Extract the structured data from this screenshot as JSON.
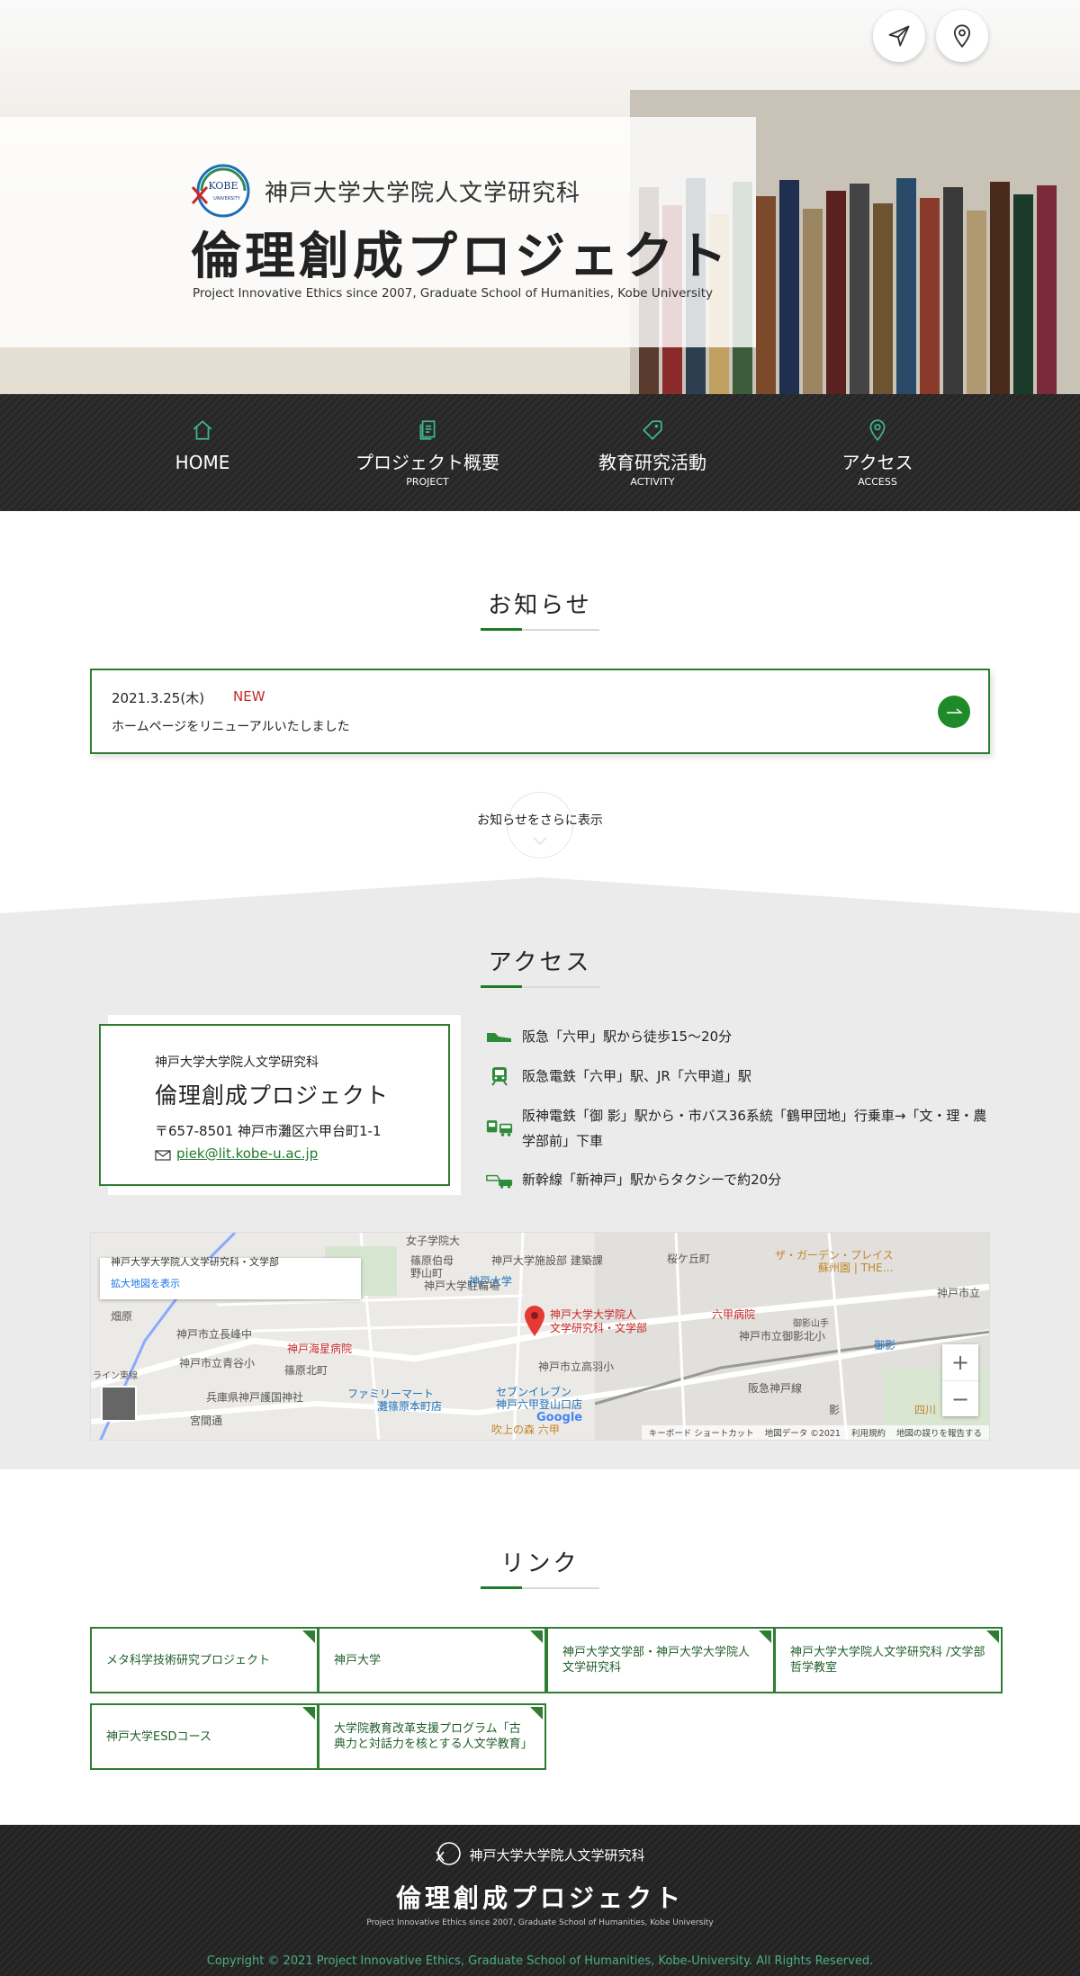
{
  "header": {
    "org_name": "神戸大学大学院人文学研究科",
    "project_title": "倫理創成プロジェクト",
    "subtitle": "Project Innovative Ethics since 2007, Graduate School of Humanities, Kobe University",
    "logo_text_top": "KOBE",
    "logo_text_bottom": "UNIVERSITY",
    "contact_icon": "send-icon",
    "access_icon": "map-pin-icon"
  },
  "nav": {
    "items": [
      {
        "label": "HOME",
        "sub": "",
        "icon": "home-icon"
      },
      {
        "label": "プロジェクト概要",
        "sub": "PROJECT",
        "icon": "document-icon"
      },
      {
        "label": "教育研究活動",
        "sub": "ACTIVITY",
        "icon": "tag-icon"
      },
      {
        "label": "アクセス",
        "sub": "ACCESS",
        "icon": "map-pin-icon"
      }
    ]
  },
  "news": {
    "title": "お知らせ",
    "items": [
      {
        "date": "2021.3.25(木)",
        "badge": "NEW",
        "text": "ホームページをリニューアルいたしました"
      }
    ],
    "more_label": "お知らせをさらに表示"
  },
  "access": {
    "title": "アクセス",
    "card": {
      "org": "神戸大学大学院人文学研究科",
      "project": "倫理創成プロジェクト",
      "address": "〒657-8501 神戸市灘区六甲台町1-1",
      "email": "piek@lit.kobe-u.ac.jp"
    },
    "routes": [
      {
        "icon": "shoe-icon",
        "text": "阪急「六甲」駅から徒歩15〜20分"
      },
      {
        "icon": "train-icon",
        "text": "阪急電鉄「六甲」駅、JR「六甲道」駅"
      },
      {
        "icon": "train-bus-icon",
        "text": "阪神電鉄「御 影」駅から・市バス36系統「鶴甲団地」行乗車→「文・理・農学部前」下車"
      },
      {
        "icon": "shinkansen-taxi-icon",
        "text": "新幹線「新神戸」駅からタクシーで約20分"
      }
    ],
    "map": {
      "place_title": "神戸大学大学院人文学研究科・文学部",
      "enlarge_label": "拡大地図を表示",
      "marker_label_1": "神戸大学大学院人",
      "marker_label_2": "文学研究科・文学部",
      "labels": [
        "女子学院大",
        "篠原伯母",
        "野山町",
        "神戸大学施設部 建築課",
        "桜ケ丘町",
        "ザ・ガーデン・プレイス",
        "蘇州園 | THE…",
        "神戸市立",
        "神戸大学駐輪場",
        "六甲病院",
        "御影山手",
        "神戸市立御影北小",
        "神戸市立長峰中",
        "神戸海星病院",
        "篠原北町",
        "神戸市立高羽小",
        "御影",
        "神戸市立青谷小",
        "阪急神戸線",
        "兵庫県神戸護国神社",
        "ファミリーマート",
        "灘篠原本町店",
        "セブンイレブン",
        "神戸六甲登山口店",
        "吹上の森 六甲",
        "四川",
        "影",
        "畑原",
        "宮間通",
        "ライン東線",
        "神戸大学"
      ],
      "zoom_in": "+",
      "zoom_out": "−",
      "footer_keyboard": "キーボード ショートカット",
      "footer_mapdata": "地図データ ©2021",
      "footer_terms": "利用規約",
      "footer_report": "地図の誤りを報告する",
      "google": "Google"
    }
  },
  "links": {
    "title": "リンク",
    "items": [
      "メタ科学技術研究プロジェクト",
      "神戸大学",
      "神戸大学文学部・神戸大学大学院人文学研究科",
      "神戸大学大学院人文学研究科 /文学部　哲学教室",
      "神戸大学ESDコース",
      "大学院教育改革支援プログラム「古典力と対話力を核とする人文学教育」"
    ]
  },
  "footer": {
    "org_name": "神戸大学大学院人文学研究科",
    "project_title": "倫理創成プロジェクト",
    "subtitle": "Project Innovative Ethics since 2007, Graduate School of Humanities, Kobe University",
    "copyright": "Copyright © 2021 Project Innovative Ethics, Graduate School of Humanities, Kobe-University. All Rights Reserved."
  },
  "colors": {
    "accent": "#2e7d32",
    "badge": "#c62828",
    "copyright": "#4caf80"
  }
}
